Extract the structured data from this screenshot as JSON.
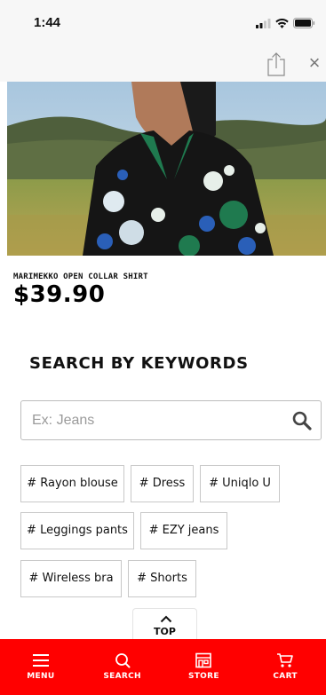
{
  "status_bar": {
    "time": "1:44"
  },
  "nav": {
    "share_icon": "share-icon",
    "close_icon": "close-icon",
    "close_glyph": "×"
  },
  "product": {
    "name": "MARIMEKKO OPEN COLLAR SHIRT",
    "price": "$39.90"
  },
  "keywords_section": {
    "title": "SEARCH BY KEYWORDS",
    "search_placeholder": "Ex: Jeans",
    "search_value": "",
    "tags": [
      "# Rayon blouse",
      "# Dress",
      "# Uniqlo U",
      "# Leggings pants",
      "# EZY jeans",
      "# Wireless bra",
      "# Shorts"
    ]
  },
  "top_button": {
    "label": "TOP"
  },
  "bottom_nav": {
    "color": "#ff0000",
    "items": [
      {
        "label": "MENU",
        "icon": "menu-icon"
      },
      {
        "label": "SEARCH",
        "icon": "search-icon"
      },
      {
        "label": "STORE",
        "icon": "store-icon"
      },
      {
        "label": "CART",
        "icon": "cart-icon"
      }
    ]
  }
}
